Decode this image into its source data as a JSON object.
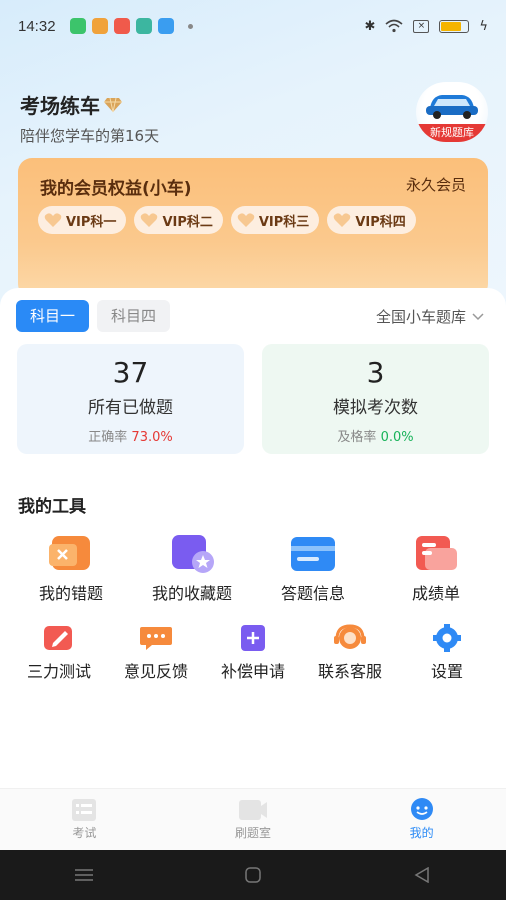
{
  "status": {
    "time": "14:32"
  },
  "header": {
    "title": "考场练车",
    "subtitle": "陪伴您学车的第16天",
    "badge_text": "新规题库"
  },
  "vip": {
    "title": "我的会员权益(小车)",
    "level": "永久会员",
    "items": [
      "VIP科一",
      "VIP科二",
      "VIP科三",
      "VIP科四"
    ]
  },
  "tabs": [
    {
      "label": "科目一",
      "active": true
    },
    {
      "label": "科目四",
      "active": false
    }
  ],
  "bank_selector": "全国小车题库",
  "stats": [
    {
      "value": "37",
      "label": "所有已做题",
      "rate_label": "正确率",
      "rate_value": "73.0%"
    },
    {
      "value": "3",
      "label": "模拟考次数",
      "rate_label": "及格率",
      "rate_value": "0.0%"
    }
  ],
  "tools": {
    "title": "我的工具",
    "row1": [
      "我的错题",
      "我的收藏题",
      "答题信息",
      "成绩单"
    ],
    "row2": [
      "三力测试",
      "意见反馈",
      "补偿申请",
      "联系客服",
      "设置"
    ]
  },
  "nav": [
    "考试",
    "刷题室",
    "我的"
  ],
  "colors": {
    "accent": "#2a8af6",
    "red": "#e53935",
    "green": "#19b35a",
    "vip": "#fbbf7a"
  }
}
